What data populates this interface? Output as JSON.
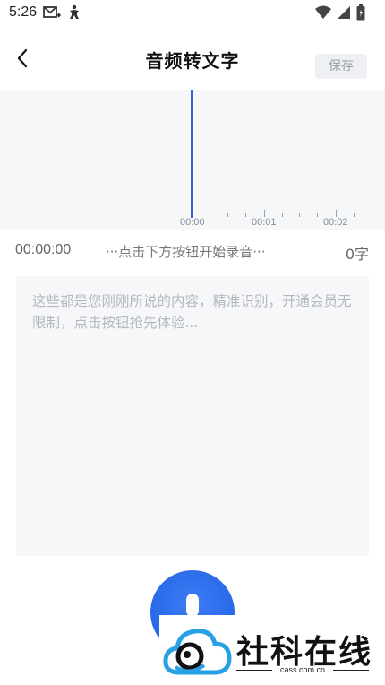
{
  "status_bar": {
    "time": "5:26"
  },
  "header": {
    "title": "音频转文字",
    "save_label": "保存"
  },
  "waveform": {
    "tick_labels": [
      "00:00",
      "00:01",
      "00:02"
    ]
  },
  "info_row": {
    "elapsed": "00:00:00",
    "hint": "···点击下方按钮开始录音···",
    "word_count": "0字"
  },
  "transcript": {
    "placeholder": "这些都是您刚刚所说的内容，精准识别，开通会员无限制，点击按钮抢先体验..."
  },
  "watermark": {
    "text": "社科在线",
    "url": "cass.com.cn"
  },
  "colors": {
    "accent": "#2b63d9",
    "panel_bg": "#f6f7f9"
  }
}
